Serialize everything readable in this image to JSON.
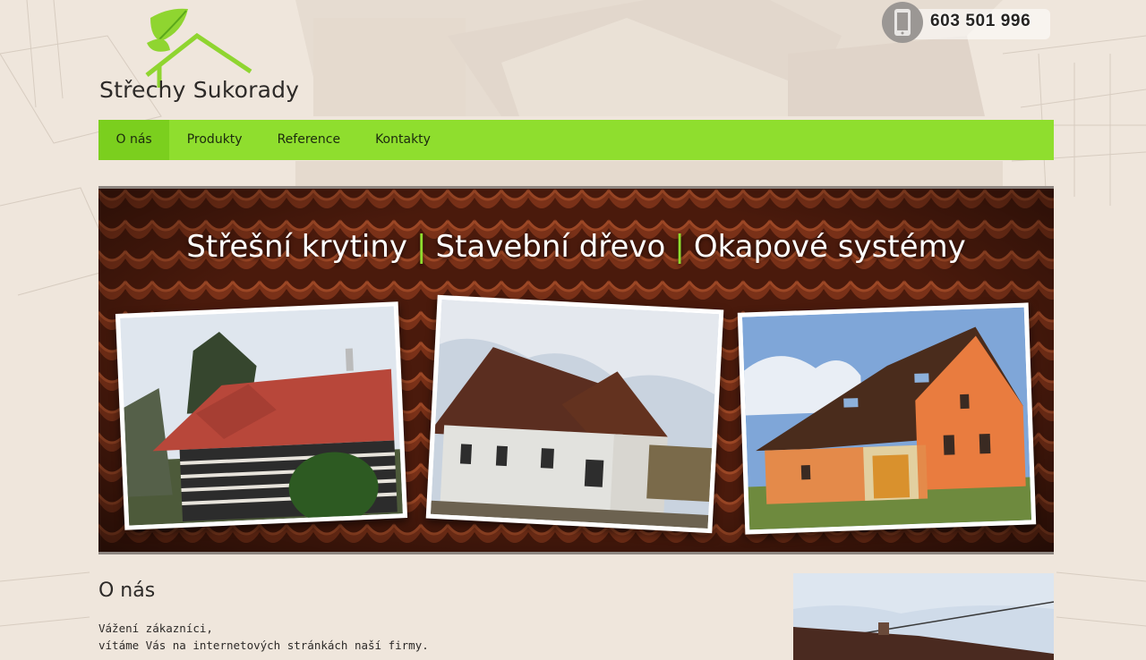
{
  "header": {
    "logo_text": "Střechy Sukorady",
    "phone_number": "603 501 996",
    "phone_icon": "mobile-phone-icon",
    "logo_icon": "leaf-house-logo"
  },
  "nav": {
    "items": [
      {
        "label": "O nás",
        "active": true
      },
      {
        "label": "Produkty",
        "active": false
      },
      {
        "label": "Reference",
        "active": false
      },
      {
        "label": "Kontakty",
        "active": false
      }
    ]
  },
  "banner": {
    "headline_1": "Střešní krytiny",
    "headline_2": "Stavební dřevo",
    "headline_3": "Okapové systémy",
    "separator": "|",
    "photos": [
      {
        "subject": "log-cabin-red-roof"
      },
      {
        "subject": "new-house-brown-roof"
      },
      {
        "subject": "brick-house-brown-roof"
      }
    ]
  },
  "content": {
    "title": "O nás",
    "line_1": "Vážení zákazníci,",
    "line_2": "vítáme Vás na internetových stránkách naší firmy."
  },
  "colors": {
    "accent_green": "#8fde2e",
    "active_green": "#7bcf1e",
    "page_bg": "#efe6dc",
    "roof_tile": "#6b2a14"
  }
}
